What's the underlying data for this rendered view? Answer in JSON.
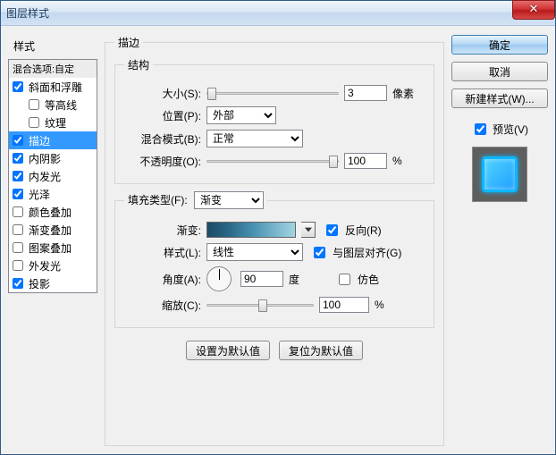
{
  "window": {
    "title": "图层样式",
    "close_glyph": "✕"
  },
  "sidebar": {
    "header": "样式",
    "blend": "混合选项:自定",
    "items": [
      {
        "label": "斜面和浮雕",
        "checked": true,
        "selected": false,
        "indent": false
      },
      {
        "label": "等高线",
        "checked": false,
        "selected": false,
        "indent": true
      },
      {
        "label": "纹理",
        "checked": false,
        "selected": false,
        "indent": true
      },
      {
        "label": "描边",
        "checked": true,
        "selected": true,
        "indent": false
      },
      {
        "label": "内阴影",
        "checked": true,
        "selected": false,
        "indent": false
      },
      {
        "label": "内发光",
        "checked": true,
        "selected": false,
        "indent": false
      },
      {
        "label": "光泽",
        "checked": true,
        "selected": false,
        "indent": false
      },
      {
        "label": "颜色叠加",
        "checked": false,
        "selected": false,
        "indent": false
      },
      {
        "label": "渐变叠加",
        "checked": false,
        "selected": false,
        "indent": false
      },
      {
        "label": "图案叠加",
        "checked": false,
        "selected": false,
        "indent": false
      },
      {
        "label": "外发光",
        "checked": false,
        "selected": false,
        "indent": false
      },
      {
        "label": "投影",
        "checked": true,
        "selected": false,
        "indent": false
      }
    ]
  },
  "main": {
    "outer_legend": "描边",
    "structure": {
      "legend": "结构",
      "size_label": "大小(S):",
      "size_value": "3",
      "size_unit": "像素",
      "position_label": "位置(P):",
      "position_value": "外部",
      "blend_label": "混合模式(B):",
      "blend_value": "正常",
      "opacity_label": "不透明度(O):",
      "opacity_value": "100",
      "opacity_unit": "%"
    },
    "fill": {
      "legend": "填充类型(F):",
      "fill_value": "渐变",
      "gradient_label": "渐变:",
      "reverse_label": "反向(R)",
      "style_label": "样式(L):",
      "style_value": "线性",
      "align_label": "与图层对齐(G)",
      "angle_label": "角度(A):",
      "angle_value": "90",
      "angle_unit": "度",
      "dither_label": "仿色",
      "scale_label": "缩放(C):",
      "scale_value": "100",
      "scale_unit": "%"
    },
    "buttons": {
      "set_default": "设置为默认值",
      "reset_default": "复位为默认值"
    }
  },
  "right": {
    "ok": "确定",
    "cancel": "取消",
    "new_style": "新建样式(W)...",
    "preview_label": "预览(V)"
  }
}
